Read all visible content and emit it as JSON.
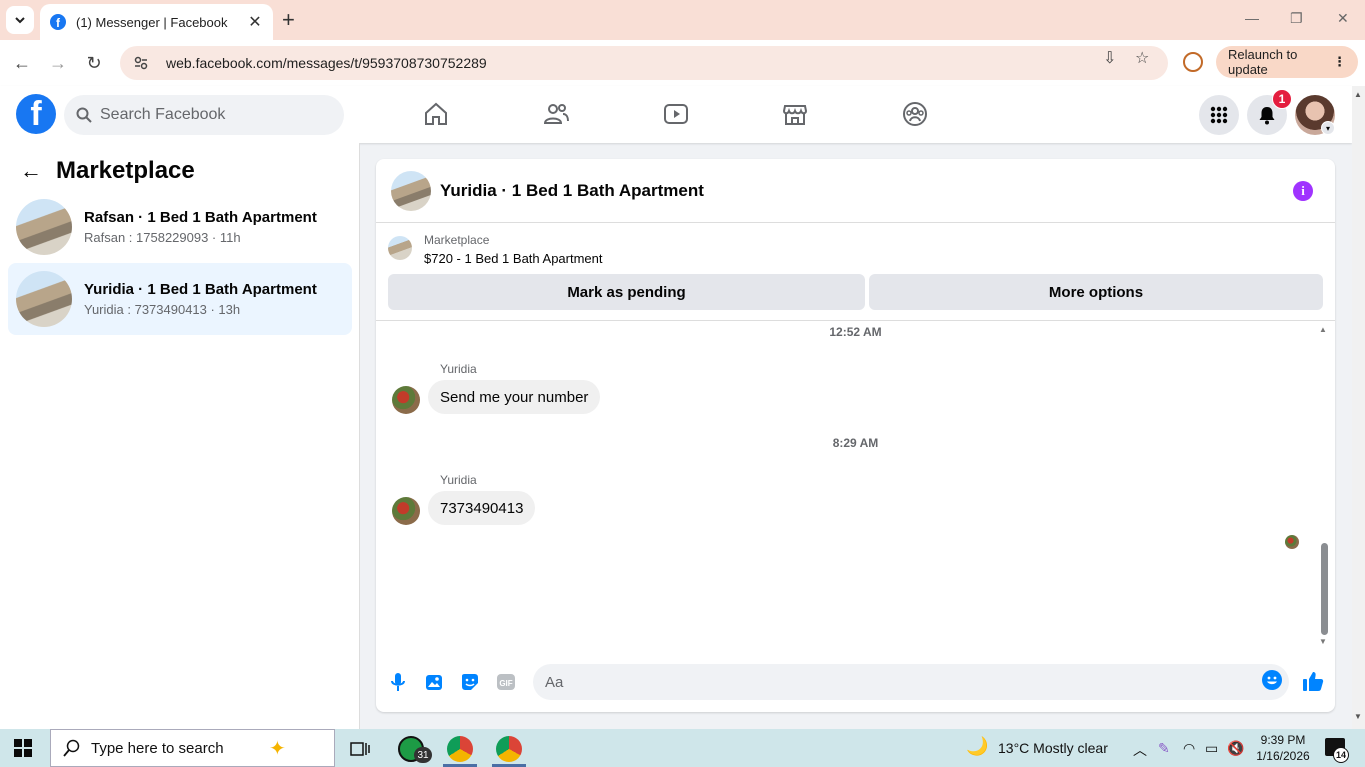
{
  "browser": {
    "tab_title": "(1) Messenger | Facebook",
    "url": "web.facebook.com/messages/t/9593708730752289",
    "relaunch_label": "Relaunch to update"
  },
  "fbnav": {
    "search_placeholder": "Search Facebook",
    "notification_count": "1"
  },
  "sidebar": {
    "title": "Marketplace",
    "conversations": [
      {
        "name": "Rafsan · 1 Bed 1 Bath Apartment",
        "sub": "Rafsan : 1758229093 · 11h",
        "active": false
      },
      {
        "name": "Yuridia · 1 Bed 1 Bath Apartment",
        "sub": "Yuridia : 7373490413 · 13h",
        "active": true
      }
    ]
  },
  "chat": {
    "title": "Yuridia · 1 Bed 1 Bath Apartment",
    "listing_category": "Marketplace",
    "listing_title": "$720 - 1 Bed 1 Bath Apartment",
    "mark_pending_label": "Mark as pending",
    "more_options_label": "More options",
    "messages": [
      {
        "timestamp": "12:52 AM",
        "author": "Yuridia",
        "text": "Send me your number"
      },
      {
        "timestamp": "8:29 AM",
        "author": "Yuridia",
        "text": "7373490413"
      }
    ],
    "composer_placeholder": "Aa"
  },
  "taskbar": {
    "search_placeholder": "Type here to search",
    "whatsapp_badge": "31",
    "weather": "13°C  Mostly clear",
    "time": "9:39 PM",
    "date": "1/16/2026",
    "notification_count": "14"
  },
  "colors": {
    "fb_blue": "#1877f2",
    "info_purple": "#a033ff",
    "notif_red": "#e41e3f",
    "tab_strip": "#f9dfd6"
  }
}
